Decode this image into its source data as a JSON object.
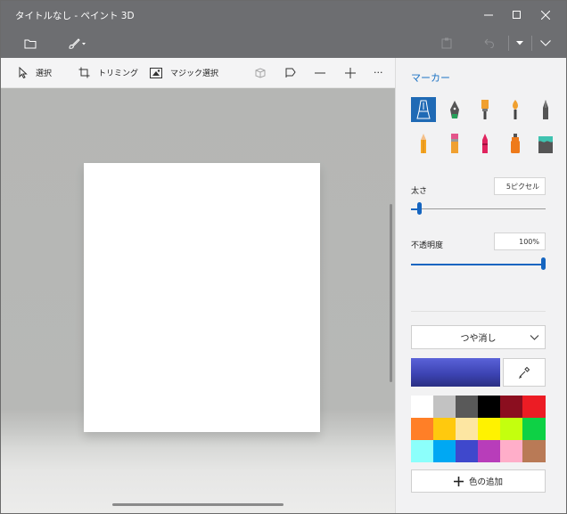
{
  "window": {
    "title": "タイトルなし - ペイント 3D"
  },
  "toolbar2": {
    "select_label": "選択",
    "crop_label": "トリミング",
    "magic_select_label": "マジック選択",
    "more_label": "···"
  },
  "panel": {
    "title": "マーカー",
    "brushes": [
      {
        "icon": "marker-icon",
        "selected": true
      },
      {
        "icon": "calligraphy-pen-icon"
      },
      {
        "icon": "oil-brush-icon"
      },
      {
        "icon": "watercolor-icon"
      },
      {
        "icon": "pixel-pen-icon"
      },
      {
        "icon": "pencil-icon"
      },
      {
        "icon": "eraser-icon"
      },
      {
        "icon": "crayon-icon"
      },
      {
        "icon": "spray-can-icon"
      },
      {
        "icon": "fill-bucket-icon"
      }
    ],
    "thickness_label": "太さ",
    "thickness_value": "5ピクセル",
    "thickness_level": 0.05,
    "opacity_label": "不透明度",
    "opacity_value": "100%",
    "opacity_level": 1.0,
    "finish_value": "つや消し",
    "current_color": "#3d44b4",
    "accent_color": "#1565c0",
    "palette": [
      "#ffffff",
      "#c2c2c2",
      "#595959",
      "#000000",
      "#8b0e1f",
      "#ec1c24",
      "#ff7f27",
      "#ffc90e",
      "#fde6a2",
      "#fff200",
      "#c4ff0e",
      "#0ed145",
      "#8cfffb",
      "#00a8f3",
      "#3f48cc",
      "#b83dba",
      "#ffaec9",
      "#b97a56"
    ],
    "add_color_label": "色の追加"
  }
}
